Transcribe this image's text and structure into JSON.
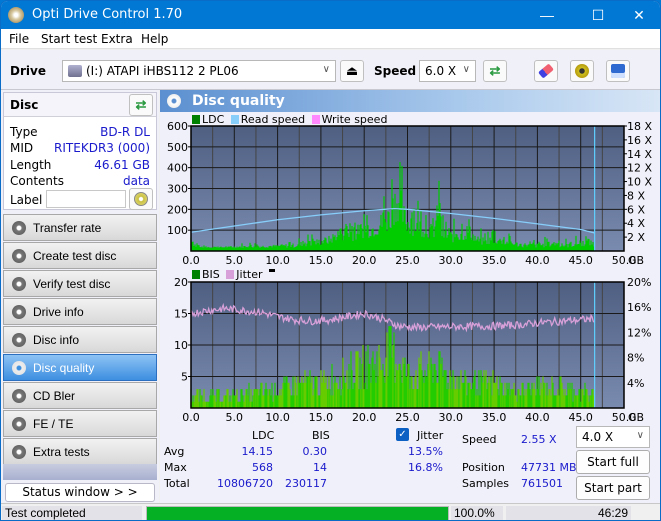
{
  "window": {
    "title": "Opti Drive Control 1.70",
    "minimize": "—",
    "maximize": "☐",
    "close": "✕"
  },
  "menu": [
    "File",
    "Start test",
    "Extra",
    "Help"
  ],
  "toolbar": {
    "drive_label": "Drive",
    "drive_value": "(I:)  ATAPI iHBS112  2 PL06",
    "speed_label": "Speed",
    "speed_value": "6.0 X",
    "eject_icon": "⏏",
    "refresh_icon": "⇄",
    "erase_icon": "eraser",
    "settings_icon": "gears",
    "save_icon": "floppy"
  },
  "disc": {
    "header": "Disc",
    "rows": [
      {
        "label": "Type",
        "value": "BD-R DL"
      },
      {
        "label": "MID",
        "value": "RITEKDR3 (000)"
      },
      {
        "label": "Length",
        "value": "46.61 GB"
      },
      {
        "label": "Contents",
        "value": "data"
      }
    ],
    "label_field_label": "Label",
    "label_field_value": ""
  },
  "nav": [
    {
      "label": "Transfer rate",
      "active": false
    },
    {
      "label": "Create test disc",
      "active": false
    },
    {
      "label": "Verify test disc",
      "active": false
    },
    {
      "label": "Drive info",
      "active": false
    },
    {
      "label": "Disc info",
      "active": false
    },
    {
      "label": "Disc quality",
      "active": true
    },
    {
      "label": "CD Bler",
      "active": false
    },
    {
      "label": "FE / TE",
      "active": false
    },
    {
      "label": "Extra tests",
      "active": false
    }
  ],
  "status_window_label": "Status window > >",
  "panel_title": "Disc quality",
  "colors": {
    "ldc": "#00cc00",
    "bis": "#22cc00",
    "read_speed": "#87cefa",
    "write_speed": "#ff88ff",
    "jitter": "#d8a0d8",
    "plot_bg_top": "#4e5f82",
    "plot_bg_bottom": "#7a8bb0",
    "accent": "#0078d4",
    "progress": "#06b025"
  },
  "chart_data": [
    {
      "type": "bar",
      "title": "LDC / Read speed",
      "legend": [
        "LDC",
        "Read speed",
        "Write speed"
      ],
      "legend_position": "top-left",
      "xlabel": "GB",
      "x_ticks": [
        "0.0",
        "5.0",
        "10.0",
        "15.0",
        "20.0",
        "25.0",
        "30.0",
        "35.0",
        "40.0",
        "45.0",
        "50.0"
      ],
      "xlim": [
        0,
        50
      ],
      "ylim": [
        0,
        600
      ],
      "y_ticks": [
        "100",
        "200",
        "300",
        "400",
        "500",
        "600"
      ],
      "y2_ticks": [
        "2 X",
        "4 X",
        "6 X",
        "8 X",
        "10 X",
        "12 X",
        "14 X",
        "16 X",
        "18 X"
      ],
      "y2lim": [
        0,
        18
      ],
      "grid": true,
      "end_marker_gb": 46.61,
      "ldc_envelope": [
        [
          0,
          150
        ],
        [
          0.5,
          60
        ],
        [
          1,
          30
        ],
        [
          2,
          25
        ],
        [
          3,
          30
        ],
        [
          4,
          25
        ],
        [
          5,
          35
        ],
        [
          6,
          40
        ],
        [
          7,
          45
        ],
        [
          8,
          40
        ],
        [
          9,
          50
        ],
        [
          10,
          45
        ],
        [
          11,
          55
        ],
        [
          12,
          60
        ],
        [
          13,
          80
        ],
        [
          14,
          90
        ],
        [
          15,
          100
        ],
        [
          16,
          120
        ],
        [
          17,
          180
        ],
        [
          18,
          200
        ],
        [
          19,
          190
        ],
        [
          20,
          250
        ],
        [
          21,
          240
        ],
        [
          22,
          300
        ],
        [
          23,
          350
        ],
        [
          23.5,
          520
        ],
        [
          24,
          568
        ],
        [
          24.5,
          380
        ],
        [
          25,
          300
        ],
        [
          26,
          280
        ],
        [
          27,
          250
        ],
        [
          28,
          200
        ],
        [
          28.7,
          470
        ],
        [
          29,
          180
        ],
        [
          30,
          160
        ],
        [
          31,
          150
        ],
        [
          32,
          220
        ],
        [
          33,
          120
        ],
        [
          34,
          100
        ],
        [
          35,
          130
        ],
        [
          36,
          100
        ],
        [
          37,
          80
        ],
        [
          38,
          70
        ],
        [
          39,
          60
        ],
        [
          40,
          60
        ],
        [
          41,
          70
        ],
        [
          42,
          80
        ],
        [
          43,
          60
        ],
        [
          44,
          70
        ],
        [
          45,
          80
        ],
        [
          46,
          100
        ],
        [
          46.61,
          60
        ]
      ],
      "read_speed": [
        [
          0,
          2.7
        ],
        [
          5,
          3.6
        ],
        [
          10,
          4.5
        ],
        [
          15,
          5.2
        ],
        [
          20,
          5.8
        ],
        [
          23.5,
          6.1
        ],
        [
          25,
          6.0
        ],
        [
          30,
          5.4
        ],
        [
          35,
          4.7
        ],
        [
          40,
          3.9
        ],
        [
          45,
          3.1
        ],
        [
          46.61,
          2.6
        ]
      ]
    },
    {
      "type": "bar",
      "title": "BIS / Jitter",
      "legend": [
        "BIS",
        "Jitter"
      ],
      "legend_position": "top-left",
      "xlabel": "GB",
      "x_ticks": [
        "0.0",
        "5.0",
        "10.0",
        "15.0",
        "20.0",
        "25.0",
        "30.0",
        "35.0",
        "40.0",
        "45.0",
        "50.0"
      ],
      "xlim": [
        0,
        50
      ],
      "ylim": [
        0,
        20
      ],
      "y_ticks": [
        "5",
        "10",
        "15",
        "20"
      ],
      "y2_ticks": [
        "4%",
        "8%",
        "12%",
        "16%",
        "20%"
      ],
      "y2lim": [
        0,
        20
      ],
      "grid": true,
      "bis_envelope": [
        [
          0,
          3
        ],
        [
          5,
          3
        ],
        [
          8,
          4
        ],
        [
          10,
          4
        ],
        [
          11,
          5
        ],
        [
          13,
          6
        ],
        [
          15,
          6
        ],
        [
          17,
          8
        ],
        [
          19,
          9
        ],
        [
          20,
          10
        ],
        [
          22,
          11
        ],
        [
          23,
          14
        ],
        [
          24,
          12
        ],
        [
          25,
          8
        ],
        [
          27,
          9
        ],
        [
          28,
          10
        ],
        [
          30,
          8
        ],
        [
          32,
          6
        ],
        [
          35,
          6
        ],
        [
          37,
          4
        ],
        [
          40,
          5
        ],
        [
          42,
          5
        ],
        [
          45,
          4
        ],
        [
          46.61,
          3
        ]
      ],
      "jitter_pct": [
        [
          0,
          15.0
        ],
        [
          2,
          15.5
        ],
        [
          4,
          15.8
        ],
        [
          6,
          15.5
        ],
        [
          8,
          15.2
        ],
        [
          10,
          14.5
        ],
        [
          12,
          14.0
        ],
        [
          14,
          13.8
        ],
        [
          16,
          14.0
        ],
        [
          18,
          14.5
        ],
        [
          20,
          15.0
        ],
        [
          22,
          14.2
        ],
        [
          24,
          13.0
        ],
        [
          26,
          12.8
        ],
        [
          30,
          12.9
        ],
        [
          35,
          13.0
        ],
        [
          38,
          13.2
        ],
        [
          40,
          13.5
        ],
        [
          43,
          13.8
        ],
        [
          45,
          14.0
        ],
        [
          46.61,
          14.2
        ]
      ]
    }
  ],
  "stats": {
    "col_ldc": "LDC",
    "col_bis": "BIS",
    "jitter_label": "Jitter",
    "jitter_checked": true,
    "rows": [
      {
        "label": "Avg",
        "ldc": "14.15",
        "bis": "0.30",
        "jitter": "13.5%"
      },
      {
        "label": "Max",
        "ldc": "568",
        "bis": "14",
        "jitter": "16.8%"
      },
      {
        "label": "Total",
        "ldc": "10806720",
        "bis": "230117",
        "jitter": ""
      }
    ],
    "speed_label": "Speed",
    "speed_value": "2.55 X",
    "position_label": "Position",
    "position_value": "47731 MB",
    "samples_label": "Samples",
    "samples_value": "761501",
    "speed_select": "4.0 X",
    "start_full": "Start full",
    "start_part": "Start part"
  },
  "statusbar": {
    "text": "Test completed",
    "progress": 100.0,
    "progress_text": "100.0%",
    "time": "46:29"
  }
}
